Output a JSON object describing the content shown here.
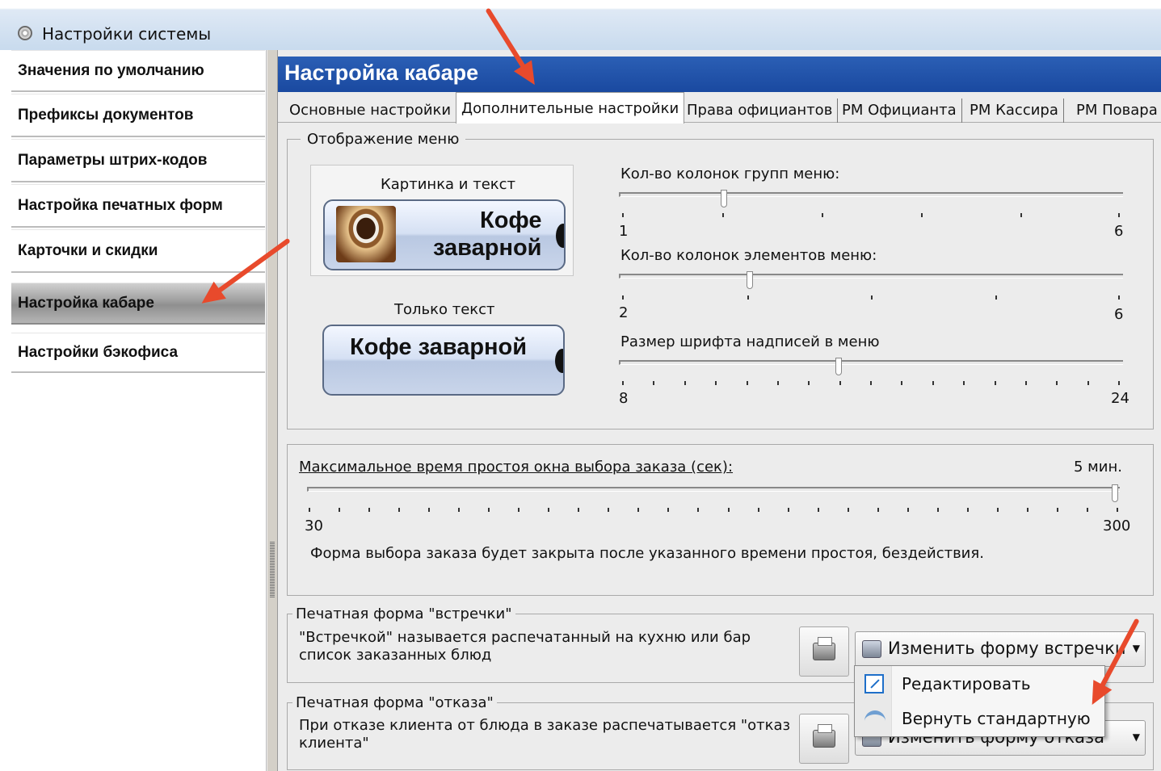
{
  "window": {
    "title": "Настройки системы"
  },
  "sidebar": {
    "items": [
      {
        "label": "Значения по умолчанию"
      },
      {
        "label": "Префиксы документов"
      },
      {
        "label": "Параметры штрих-кодов"
      },
      {
        "label": "Настройка печатных форм"
      },
      {
        "label": "Карточки и скидки"
      },
      {
        "label": "Настройка кабаре",
        "active": true
      },
      {
        "label": "Настройки бэкофиса"
      }
    ]
  },
  "page": {
    "title": "Настройка кабаре"
  },
  "tabs": [
    {
      "label": "Основные настройки"
    },
    {
      "label": "Дополнительные настройки",
      "active": true
    },
    {
      "label": "Права официантов"
    },
    {
      "label": "РМ Официанта"
    },
    {
      "label": "РМ Кассира"
    },
    {
      "label": "РМ Повара"
    }
  ],
  "menu_display": {
    "group_label": "Отображение меню",
    "preview_image_text": {
      "label": "Картинка и текст",
      "button_line1": "Кофе",
      "button_line2": "заварной",
      "image_icon": "coffee-cup-image"
    },
    "preview_text_only": {
      "label": "Только текст",
      "button_text": "Кофе заварной"
    },
    "sliders": [
      {
        "label": "Кол-во колонок групп меню:",
        "min": "1",
        "max": "6",
        "value": 2
      },
      {
        "label": "Кол-во колонок элементов меню:",
        "min": "2",
        "max": "6",
        "value": 3
      },
      {
        "label": "Размер шрифта надписей в меню",
        "min": "8",
        "max": "24",
        "value": 14
      }
    ]
  },
  "idle": {
    "label": "Максимальное время простоя окна выбора заказа (сек):",
    "value_text": "5 мин.",
    "min": "30",
    "max": "300",
    "value": 300,
    "note": "Форма выбора заказа будет закрыта после указанного времени простоя, бездействия."
  },
  "print_meeting": {
    "group_label": "Печатная форма \"встречки\"",
    "description": "\"Встречкой\" называется распечатанный на кухню или бар список заказанных блюд",
    "dropdown_label": "Изменить форму встречки",
    "menu_items": [
      {
        "label": "Редактировать",
        "icon": "edit-icon"
      },
      {
        "label": "Вернуть стандартную",
        "icon": "undo-icon"
      }
    ]
  },
  "print_refusal": {
    "group_label": "Печатная форма \"отказа\"",
    "description": "При отказе клиента от блюда в заказе распечатывается \"отказ клиента\"",
    "dropdown_label": "Изменить форму отказа"
  },
  "colors": {
    "header_blue": "#1f4fa6",
    "annotation_arrow": "#e84a2c",
    "active_sidebar": "#9d9d9d"
  }
}
